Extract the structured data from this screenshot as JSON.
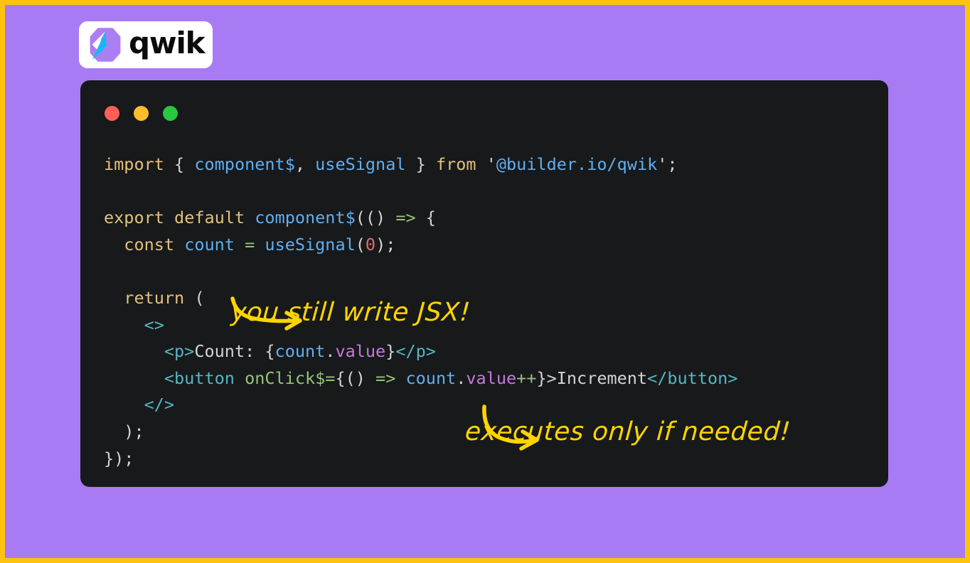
{
  "theme": {
    "frame_border_color": "#FFC20E",
    "canvas_background": "#A87BF5",
    "card_background": "#17191B",
    "annotation_color": "#FFD400"
  },
  "brand": {
    "logo_icon": "qwik-logo-icon",
    "name": "qwik",
    "logo_purple": "#AC7EF4",
    "logo_cyan": "#18B6F6"
  },
  "window_controls": [
    {
      "name": "close-dot",
      "color": "#FF5F57"
    },
    {
      "name": "minimize-dot",
      "color": "#FFBD2E"
    },
    {
      "name": "maximize-dot",
      "color": "#28C840"
    }
  ],
  "code": {
    "language": "tsx",
    "lines": [
      {
        "id": "line-1",
        "tokens": [
          {
            "t": "import",
            "c": "t-kw"
          },
          {
            "t": " ",
            "c": "t-punc"
          },
          {
            "t": "{",
            "c": "t-punc"
          },
          {
            "t": " ",
            "c": "t-punc"
          },
          {
            "t": "component$",
            "c": "t-fn"
          },
          {
            "t": ",",
            "c": "t-punc"
          },
          {
            "t": " ",
            "c": "t-punc"
          },
          {
            "t": "useSignal",
            "c": "t-fn"
          },
          {
            "t": " ",
            "c": "t-punc"
          },
          {
            "t": "}",
            "c": "t-punc"
          },
          {
            "t": " ",
            "c": "t-punc"
          },
          {
            "t": "from",
            "c": "t-kw"
          },
          {
            "t": " ",
            "c": "t-punc"
          },
          {
            "t": "'",
            "c": "t-quote"
          },
          {
            "t": "@builder.io/qwik",
            "c": "t-str"
          },
          {
            "t": "'",
            "c": "t-quote"
          },
          {
            "t": ";",
            "c": "t-punc"
          }
        ]
      },
      {
        "id": "line-2",
        "tokens": []
      },
      {
        "id": "line-3",
        "tokens": [
          {
            "t": "export",
            "c": "t-kw"
          },
          {
            "t": " ",
            "c": "t-punc"
          },
          {
            "t": "default",
            "c": "t-kw"
          },
          {
            "t": " ",
            "c": "t-punc"
          },
          {
            "t": "component$",
            "c": "t-fn"
          },
          {
            "t": "((",
            "c": "t-punc"
          },
          {
            "t": ")",
            "c": "t-punc"
          },
          {
            "t": " ",
            "c": "t-punc"
          },
          {
            "t": "=>",
            "c": "t-op"
          },
          {
            "t": " ",
            "c": "t-punc"
          },
          {
            "t": "{",
            "c": "t-punc"
          }
        ]
      },
      {
        "id": "line-4",
        "tokens": [
          {
            "t": "  ",
            "c": "t-punc"
          },
          {
            "t": "const",
            "c": "t-kw"
          },
          {
            "t": " ",
            "c": "t-punc"
          },
          {
            "t": "count",
            "c": "t-fn"
          },
          {
            "t": " ",
            "c": "t-punc"
          },
          {
            "t": "=",
            "c": "t-op"
          },
          {
            "t": " ",
            "c": "t-punc"
          },
          {
            "t": "useSignal",
            "c": "t-fn"
          },
          {
            "t": "(",
            "c": "t-punc"
          },
          {
            "t": "0",
            "c": "t-num"
          },
          {
            "t": ");",
            "c": "t-punc"
          }
        ]
      },
      {
        "id": "line-5",
        "tokens": []
      },
      {
        "id": "line-6",
        "tokens": [
          {
            "t": "  ",
            "c": "t-punc"
          },
          {
            "t": "return",
            "c": "t-kw"
          },
          {
            "t": " ",
            "c": "t-punc"
          },
          {
            "t": "(",
            "c": "t-punc"
          }
        ]
      },
      {
        "id": "line-7",
        "tokens": [
          {
            "t": "    ",
            "c": "t-punc"
          },
          {
            "t": "<>",
            "c": "t-tag"
          }
        ]
      },
      {
        "id": "line-8",
        "tokens": [
          {
            "t": "      ",
            "c": "t-punc"
          },
          {
            "t": "<p>",
            "c": "t-tag"
          },
          {
            "t": "Count: ",
            "c": "t-text"
          },
          {
            "t": "{",
            "c": "t-punc"
          },
          {
            "t": "count",
            "c": "t-fn"
          },
          {
            "t": ".",
            "c": "t-punc"
          },
          {
            "t": "value",
            "c": "t-prop"
          },
          {
            "t": "}",
            "c": "t-punc"
          },
          {
            "t": "</p>",
            "c": "t-tag"
          }
        ]
      },
      {
        "id": "line-9",
        "tokens": [
          {
            "t": "      ",
            "c": "t-punc"
          },
          {
            "t": "<button",
            "c": "t-tag"
          },
          {
            "t": " ",
            "c": "t-punc"
          },
          {
            "t": "onClick$",
            "c": "t-op"
          },
          {
            "t": "=",
            "c": "t-op"
          },
          {
            "t": "{()",
            "c": "t-punc"
          },
          {
            "t": " ",
            "c": "t-punc"
          },
          {
            "t": "=>",
            "c": "t-op"
          },
          {
            "t": " ",
            "c": "t-punc"
          },
          {
            "t": "count",
            "c": "t-fn"
          },
          {
            "t": ".",
            "c": "t-punc"
          },
          {
            "t": "value",
            "c": "t-prop"
          },
          {
            "t": "++",
            "c": "t-op"
          },
          {
            "t": "}>",
            "c": "t-punc"
          },
          {
            "t": "Increment",
            "c": "t-text"
          },
          {
            "t": "</button>",
            "c": "t-tag"
          }
        ]
      },
      {
        "id": "line-10",
        "tokens": [
          {
            "t": "    ",
            "c": "t-punc"
          },
          {
            "t": "</>",
            "c": "t-tag"
          }
        ]
      },
      {
        "id": "line-11",
        "tokens": [
          {
            "t": "  ",
            "c": "t-punc"
          },
          {
            "t": ");",
            "c": "t-punc"
          }
        ]
      },
      {
        "id": "line-12",
        "tokens": [
          {
            "t": "});",
            "c": "t-punc"
          }
        ]
      }
    ]
  },
  "annotations": [
    {
      "id": "annotation-jsx",
      "text": "you still write JSX!",
      "arrow": "curved-arrow-right-icon"
    },
    {
      "id": "annotation-lazy",
      "text": "executes only if needed!",
      "arrow": "curved-arrow-right-icon"
    }
  ]
}
